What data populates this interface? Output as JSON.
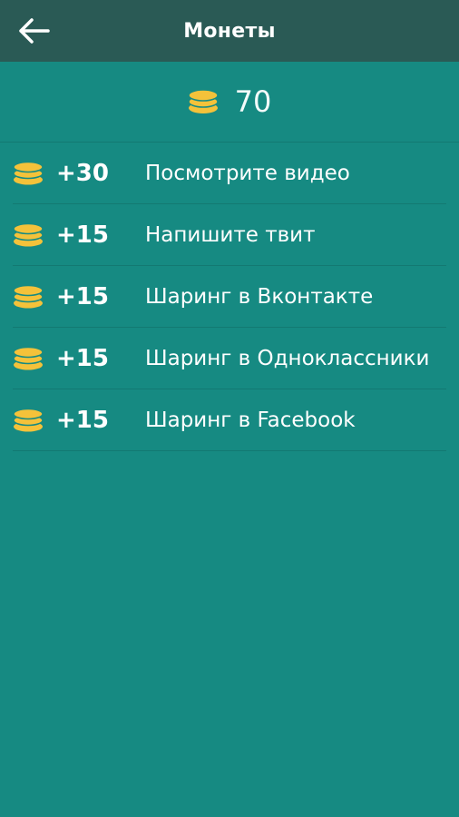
{
  "header": {
    "title": "Монеты",
    "back_icon": "arrow-left-icon"
  },
  "balance": {
    "icon": "coin-stack-icon",
    "value": "70"
  },
  "colors": {
    "background": "#168a82",
    "header": "#2a5a55",
    "coin": "#f4c23a"
  },
  "rewards": [
    {
      "amount": "+30",
      "label": "Посмотрите видео"
    },
    {
      "amount": "+15",
      "label": "Напишите твит"
    },
    {
      "amount": "+15",
      "label": "Шаринг в Вконтакте"
    },
    {
      "amount": "+15",
      "label": "Шаринг в Одноклассники"
    },
    {
      "amount": "+15",
      "label": "Шаринг в Facebook"
    }
  ]
}
